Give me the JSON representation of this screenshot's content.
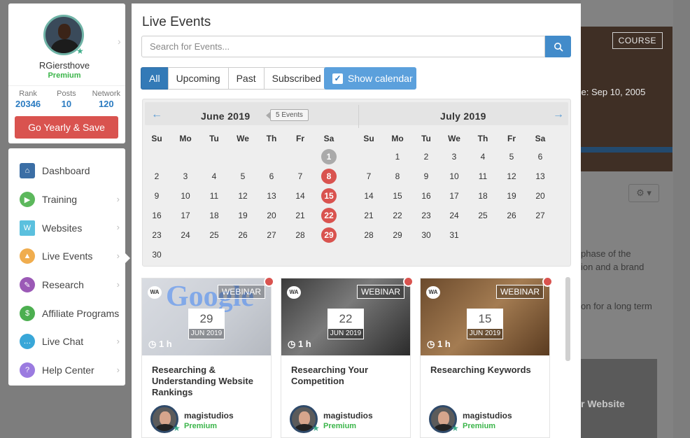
{
  "profile": {
    "username": "RGiersthove",
    "tier": "Premium",
    "stats": [
      {
        "label": "Rank",
        "value": "20346"
      },
      {
        "label": "Posts",
        "value": "10"
      },
      {
        "label": "Network",
        "value": "120"
      }
    ],
    "cta_label": "Go Yearly & Save"
  },
  "nav": {
    "items": [
      {
        "label": "Dashboard",
        "icon": "home-icon",
        "color": "#3b6ea5"
      },
      {
        "label": "Training",
        "icon": "play-icon",
        "color": "#5cb85c"
      },
      {
        "label": "Websites",
        "icon": "website-icon",
        "color": "#5bc0de"
      },
      {
        "label": "Live Events",
        "icon": "live-events-icon",
        "color": "#f0ad4e"
      },
      {
        "label": "Research",
        "icon": "research-icon",
        "color": "#9b59b6"
      },
      {
        "label": "Affiliate Programs",
        "icon": "affiliate-icon",
        "color": "#4caf50"
      },
      {
        "label": "Live Chat",
        "icon": "chat-icon",
        "color": "#39a7d8"
      },
      {
        "label": "Help Center",
        "icon": "help-icon",
        "color": "#9b7be0"
      }
    ]
  },
  "panel": {
    "title": "Live Events",
    "search_placeholder": "Search for Events...",
    "tabs": [
      "All",
      "Upcoming",
      "Past",
      "Subscribed"
    ],
    "calendar_toggle": "Show calendar"
  },
  "calendar": {
    "months": [
      {
        "name": "June 2019",
        "event_badge": "5 Events",
        "weekdays": [
          "Su",
          "Mo",
          "Tu",
          "We",
          "Th",
          "Fr",
          "Sa"
        ],
        "weeks": [
          [
            "",
            "",
            "",
            "",
            "",
            "",
            "1"
          ],
          [
            "2",
            "3",
            "4",
            "5",
            "6",
            "7",
            "8"
          ],
          [
            "9",
            "10",
            "11",
            "12",
            "13",
            "14",
            "15"
          ],
          [
            "16",
            "17",
            "18",
            "19",
            "20",
            "21",
            "22"
          ],
          [
            "23",
            "24",
            "25",
            "26",
            "27",
            "28",
            "29"
          ],
          [
            "30",
            "",
            "",
            "",
            "",
            "",
            ""
          ]
        ],
        "highlighted": [
          "8",
          "15",
          "22",
          "29"
        ],
        "today": "1"
      },
      {
        "name": "July 2019",
        "weekdays": [
          "Su",
          "Mo",
          "Tu",
          "We",
          "Th",
          "Fr",
          "Sa"
        ],
        "weeks": [
          [
            "",
            "1",
            "2",
            "3",
            "4",
            "5",
            "6"
          ],
          [
            "7",
            "8",
            "9",
            "10",
            "11",
            "12",
            "13"
          ],
          [
            "14",
            "15",
            "16",
            "17",
            "18",
            "19",
            "20"
          ],
          [
            "21",
            "22",
            "23",
            "24",
            "25",
            "26",
            "27"
          ],
          [
            "28",
            "29",
            "30",
            "31",
            "",
            "",
            ""
          ]
        ],
        "highlighted": [],
        "today": ""
      }
    ]
  },
  "events": [
    {
      "type": "WEBINAR",
      "day": "29",
      "month": "JUN 2019",
      "duration": "1 h",
      "title": "Researching & Understanding Website Rankings",
      "author": "magistudios",
      "tier": "Premium",
      "image": "google-logo-image"
    },
    {
      "type": "WEBINAR",
      "day": "22",
      "month": "JUN 2019",
      "duration": "1 h",
      "title": "Researching Your Competition",
      "author": "magistudios",
      "tier": "Premium",
      "image": "chess-image"
    },
    {
      "type": "WEBINAR",
      "day": "15",
      "month": "JUN 2019",
      "duration": "1 h",
      "title": "Researching Keywords",
      "author": "magistudios",
      "tier": "Premium",
      "image": "scrabble-tiles-image"
    }
  ],
  "background": {
    "course_badge": "COURSE",
    "since_text": "ce: Sep 10, 2005",
    "lines": [
      "phase of the",
      "ion and a brand",
      "on for a long term"
    ],
    "thumb_text": "r Website"
  },
  "colors": {
    "accent": "#337ab7",
    "danger": "#d9534f",
    "premium": "#3bb54a"
  }
}
